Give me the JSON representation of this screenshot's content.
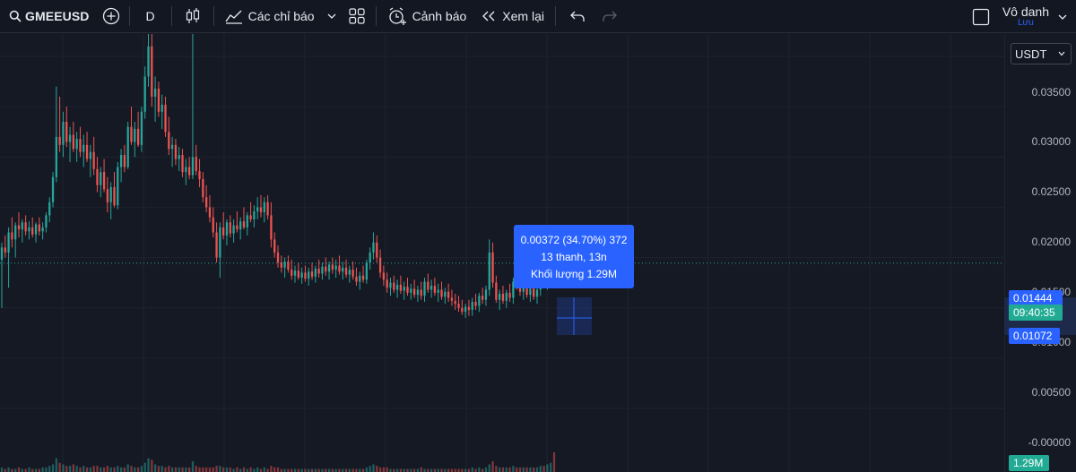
{
  "toolbar": {
    "symbol": "GMEEUSD",
    "interval": "D",
    "indicators_label": "Các chỉ báo",
    "alert_label": "Cảnh báo",
    "replay_label": "Xem lại",
    "user_name": "Vô danh",
    "user_sub": "Lưu"
  },
  "price_axis": {
    "currency": "USDT",
    "ticks": [
      "0.03500",
      "0.03000",
      "0.02500",
      "0.02000",
      "0.01500",
      "0.01000",
      "0.00500",
      "-0.00000"
    ],
    "last_price": "0.01444",
    "countdown": "09:40:35",
    "crosshair_price": "0.01072",
    "volume": "1.29M"
  },
  "tooltip": {
    "line1": "0.00372 (34.70%) 372",
    "line2": "13 thanh, 13n",
    "line3": "Khối lượng 1.29M"
  },
  "colors": {
    "up": "#26a69a",
    "down": "#ef5350",
    "background": "#151924",
    "accent": "#2962ff"
  },
  "chart_data": {
    "type": "candlestick",
    "title": "",
    "ylim": [
      -0.0005,
      0.0385
    ],
    "candles": [
      [
        0.0148,
        0.0165,
        0.01,
        0.016
      ],
      [
        0.016,
        0.0172,
        0.015,
        0.0155
      ],
      [
        0.0155,
        0.018,
        0.012,
        0.0175
      ],
      [
        0.0175,
        0.019,
        0.016,
        0.0168
      ],
      [
        0.0168,
        0.0185,
        0.015,
        0.0182
      ],
      [
        0.0182,
        0.0195,
        0.017,
        0.0178
      ],
      [
        0.0178,
        0.0188,
        0.0165,
        0.0185
      ],
      [
        0.0185,
        0.0192,
        0.0172,
        0.0176
      ],
      [
        0.0176,
        0.0186,
        0.0168,
        0.018
      ],
      [
        0.018,
        0.019,
        0.017,
        0.0173
      ],
      [
        0.0173,
        0.0185,
        0.0165,
        0.0183
      ],
      [
        0.0183,
        0.019,
        0.0172,
        0.0176
      ],
      [
        0.0176,
        0.0185,
        0.0168,
        0.018
      ],
      [
        0.018,
        0.0195,
        0.0175,
        0.0192
      ],
      [
        0.0192,
        0.021,
        0.0185,
        0.0205
      ],
      [
        0.0205,
        0.0235,
        0.02,
        0.023
      ],
      [
        0.023,
        0.032,
        0.0225,
        0.027
      ],
      [
        0.027,
        0.031,
        0.0255,
        0.0262
      ],
      [
        0.0262,
        0.0295,
        0.025,
        0.0285
      ],
      [
        0.0285,
        0.03,
        0.026,
        0.0265
      ],
      [
        0.0265,
        0.028,
        0.0245,
        0.0272
      ],
      [
        0.0272,
        0.0285,
        0.0255,
        0.0258
      ],
      [
        0.0258,
        0.0275,
        0.0245,
        0.0268
      ],
      [
        0.0268,
        0.028,
        0.025,
        0.0255
      ],
      [
        0.0255,
        0.0272,
        0.024,
        0.0262
      ],
      [
        0.0262,
        0.0275,
        0.0245,
        0.0248
      ],
      [
        0.0248,
        0.0262,
        0.023,
        0.0255
      ],
      [
        0.0255,
        0.027,
        0.0232,
        0.0238
      ],
      [
        0.0238,
        0.025,
        0.0215,
        0.0222
      ],
      [
        0.0222,
        0.024,
        0.021,
        0.0235
      ],
      [
        0.0235,
        0.0248,
        0.0215,
        0.0218
      ],
      [
        0.0218,
        0.023,
        0.0195,
        0.0205
      ],
      [
        0.0205,
        0.0225,
        0.0188,
        0.022
      ],
      [
        0.022,
        0.0235,
        0.02,
        0.0202
      ],
      [
        0.0202,
        0.0245,
        0.0198,
        0.024
      ],
      [
        0.024,
        0.0258,
        0.0225,
        0.0252
      ],
      [
        0.0252,
        0.0262,
        0.0235,
        0.024
      ],
      [
        0.024,
        0.0285,
        0.0238,
        0.028
      ],
      [
        0.028,
        0.03,
        0.0262,
        0.0265
      ],
      [
        0.0265,
        0.0285,
        0.025,
        0.0278
      ],
      [
        0.0278,
        0.0295,
        0.026,
        0.0262
      ],
      [
        0.0262,
        0.03,
        0.0255,
        0.0295
      ],
      [
        0.0295,
        0.034,
        0.0288,
        0.033
      ],
      [
        0.033,
        0.0385,
        0.032,
        0.036
      ],
      [
        0.036,
        0.0385,
        0.03,
        0.031
      ],
      [
        0.031,
        0.033,
        0.0285,
        0.0318
      ],
      [
        0.0318,
        0.0325,
        0.029,
        0.0295
      ],
      [
        0.0295,
        0.0312,
        0.0278,
        0.0302
      ],
      [
        0.0302,
        0.031,
        0.027,
        0.0275
      ],
      [
        0.0275,
        0.029,
        0.0252,
        0.0258
      ],
      [
        0.0258,
        0.027,
        0.024,
        0.0262
      ],
      [
        0.0262,
        0.0268,
        0.0242,
        0.0248
      ],
      [
        0.0248,
        0.026,
        0.0236,
        0.0252
      ],
      [
        0.0252,
        0.0258,
        0.023,
        0.0235
      ],
      [
        0.0235,
        0.0248,
        0.0222,
        0.024
      ],
      [
        0.024,
        0.025,
        0.0228,
        0.0232
      ],
      [
        0.0232,
        0.0385,
        0.0228,
        0.025
      ],
      [
        0.025,
        0.0262,
        0.0232,
        0.0236
      ],
      [
        0.0236,
        0.0248,
        0.022,
        0.0228
      ],
      [
        0.0228,
        0.0235,
        0.0205,
        0.021
      ],
      [
        0.021,
        0.0222,
        0.0195,
        0.02
      ],
      [
        0.02,
        0.0212,
        0.0185,
        0.019
      ],
      [
        0.019,
        0.02,
        0.017,
        0.0175
      ],
      [
        0.0175,
        0.0185,
        0.0145,
        0.015
      ],
      [
        0.015,
        0.0185,
        0.013,
        0.018
      ],
      [
        0.018,
        0.0195,
        0.0168,
        0.0172
      ],
      [
        0.0172,
        0.0188,
        0.0162,
        0.0185
      ],
      [
        0.0185,
        0.0192,
        0.017,
        0.0174
      ],
      [
        0.0174,
        0.0188,
        0.0165,
        0.0182
      ],
      [
        0.0182,
        0.0196,
        0.0175,
        0.0178
      ],
      [
        0.0178,
        0.019,
        0.0168,
        0.0186
      ],
      [
        0.0186,
        0.02,
        0.0178,
        0.018
      ],
      [
        0.018,
        0.0195,
        0.0172,
        0.0192
      ],
      [
        0.0192,
        0.0205,
        0.0185,
        0.0188
      ],
      [
        0.0188,
        0.0202,
        0.018,
        0.0196
      ],
      [
        0.0196,
        0.021,
        0.0188,
        0.02
      ],
      [
        0.02,
        0.0212,
        0.019,
        0.0195
      ],
      [
        0.0195,
        0.021,
        0.0185,
        0.0205
      ],
      [
        0.0205,
        0.0212,
        0.0188,
        0.0192
      ],
      [
        0.0192,
        0.0205,
        0.016,
        0.0168
      ],
      [
        0.0168,
        0.0175,
        0.015,
        0.0155
      ],
      [
        0.0155,
        0.0162,
        0.014,
        0.0145
      ],
      [
        0.0145,
        0.0152,
        0.0135,
        0.014
      ],
      [
        0.014,
        0.015,
        0.013,
        0.0146
      ],
      [
        0.0146,
        0.0152,
        0.0135,
        0.0138
      ],
      [
        0.0138,
        0.0148,
        0.0128,
        0.0132
      ],
      [
        0.0132,
        0.0142,
        0.0125,
        0.0137
      ],
      [
        0.0137,
        0.0145,
        0.0128,
        0.013
      ],
      [
        0.013,
        0.014,
        0.0124,
        0.0135
      ],
      [
        0.0135,
        0.0142,
        0.0126,
        0.0129
      ],
      [
        0.0129,
        0.014,
        0.0122,
        0.0136
      ],
      [
        0.0136,
        0.0145,
        0.0128,
        0.0131
      ],
      [
        0.0131,
        0.0142,
        0.0125,
        0.0139
      ],
      [
        0.0139,
        0.0148,
        0.013,
        0.0134
      ],
      [
        0.0134,
        0.0145,
        0.0128,
        0.0141
      ],
      [
        0.0141,
        0.015,
        0.0132,
        0.0136
      ],
      [
        0.0136,
        0.0146,
        0.0128,
        0.0143
      ],
      [
        0.0143,
        0.015,
        0.0134,
        0.0138
      ],
      [
        0.0138,
        0.0148,
        0.013,
        0.0142
      ],
      [
        0.0142,
        0.0152,
        0.0133,
        0.0136
      ],
      [
        0.0136,
        0.0146,
        0.0128,
        0.014
      ],
      [
        0.014,
        0.0148,
        0.013,
        0.0133
      ],
      [
        0.0133,
        0.0142,
        0.0125,
        0.0138
      ],
      [
        0.0138,
        0.0146,
        0.0128,
        0.0131
      ],
      [
        0.0131,
        0.014,
        0.0122,
        0.0126
      ],
      [
        0.0126,
        0.0136,
        0.0118,
        0.0132
      ],
      [
        0.0132,
        0.0142,
        0.0125,
        0.0128
      ],
      [
        0.0128,
        0.0148,
        0.0124,
        0.0145
      ],
      [
        0.0145,
        0.016,
        0.0138,
        0.0155
      ],
      [
        0.0155,
        0.0175,
        0.0148,
        0.0165
      ],
      [
        0.0165,
        0.0172,
        0.0145,
        0.015
      ],
      [
        0.015,
        0.0158,
        0.013,
        0.0135
      ],
      [
        0.0135,
        0.0142,
        0.0122,
        0.0128
      ],
      [
        0.0128,
        0.0135,
        0.0115,
        0.012
      ],
      [
        0.012,
        0.013,
        0.0112,
        0.0125
      ],
      [
        0.0125,
        0.0132,
        0.0115,
        0.0118
      ],
      [
        0.0118,
        0.0128,
        0.011,
        0.0123
      ],
      [
        0.0123,
        0.0132,
        0.0114,
        0.0117
      ],
      [
        0.0117,
        0.0126,
        0.0108,
        0.0121
      ],
      [
        0.0121,
        0.013,
        0.0112,
        0.0115
      ],
      [
        0.0115,
        0.0124,
        0.0108,
        0.0119
      ],
      [
        0.0119,
        0.0128,
        0.011,
        0.0113
      ],
      [
        0.0113,
        0.0122,
        0.0106,
        0.0118
      ],
      [
        0.0118,
        0.0126,
        0.0108,
        0.0112
      ],
      [
        0.0112,
        0.013,
        0.0106,
        0.0126
      ],
      [
        0.0126,
        0.0134,
        0.0115,
        0.0118
      ],
      [
        0.0118,
        0.0128,
        0.011,
        0.0122
      ],
      [
        0.0122,
        0.013,
        0.0112,
        0.0115
      ],
      [
        0.0115,
        0.0124,
        0.0106,
        0.0118
      ],
      [
        0.0118,
        0.0126,
        0.0108,
        0.0111
      ],
      [
        0.0111,
        0.012,
        0.0104,
        0.0116
      ],
      [
        0.0116,
        0.0124,
        0.0106,
        0.011
      ],
      [
        0.011,
        0.0118,
        0.0102,
        0.0107
      ],
      [
        0.0107,
        0.0114,
        0.0098,
        0.0104
      ],
      [
        0.0104,
        0.0112,
        0.0096,
        0.01
      ],
      [
        0.01,
        0.0108,
        0.0093,
        0.0096
      ],
      [
        0.0096,
        0.0104,
        0.009,
        0.0101
      ],
      [
        0.0101,
        0.0108,
        0.0092,
        0.0098
      ],
      [
        0.0098,
        0.011,
        0.0092,
        0.0106
      ],
      [
        0.0106,
        0.0114,
        0.0098,
        0.0102
      ],
      [
        0.0102,
        0.0115,
        0.0096,
        0.0112
      ],
      [
        0.0112,
        0.012,
        0.0104,
        0.0108
      ],
      [
        0.0108,
        0.0122,
        0.0102,
        0.0118
      ],
      [
        0.0118,
        0.0168,
        0.0112,
        0.0155
      ],
      [
        0.0155,
        0.0165,
        0.012,
        0.0125
      ],
      [
        0.0125,
        0.0132,
        0.0105,
        0.0108
      ],
      [
        0.0108,
        0.0118,
        0.0098,
        0.0114
      ],
      [
        0.0114,
        0.0122,
        0.0104,
        0.0107
      ],
      [
        0.0107,
        0.0118,
        0.01,
        0.0115
      ],
      [
        0.0115,
        0.0124,
        0.0106,
        0.011
      ],
      [
        0.011,
        0.013,
        0.0104,
        0.0126
      ],
      [
        0.0126,
        0.014,
        0.0118,
        0.0122
      ],
      [
        0.0122,
        0.0132,
        0.0112,
        0.0116
      ],
      [
        0.0116,
        0.0126,
        0.0108,
        0.012
      ],
      [
        0.012,
        0.0128,
        0.011,
        0.0113
      ],
      [
        0.0113,
        0.0124,
        0.0106,
        0.0119
      ],
      [
        0.0119,
        0.0126,
        0.0108,
        0.0111
      ],
      [
        0.0111,
        0.0122,
        0.0104,
        0.0118
      ],
      [
        0.0118,
        0.0138,
        0.0112,
        0.0134
      ],
      [
        0.0134,
        0.0142,
        0.012,
        0.0125
      ],
      [
        0.0125,
        0.014,
        0.0118,
        0.0136
      ],
      [
        0.0136,
        0.0152,
        0.013,
        0.0148
      ],
      [
        0.0148,
        0.016,
        0.014,
        0.0144
      ]
    ],
    "volumes": [
      0.3,
      0.2,
      0.3,
      0.2,
      0.2,
      0.3,
      0.2,
      0.2,
      0.3,
      0.2,
      0.2,
      0.2,
      0.3,
      0.3,
      0.4,
      0.5,
      0.9,
      0.6,
      0.5,
      0.4,
      0.4,
      0.5,
      0.4,
      0.3,
      0.4,
      0.3,
      0.3,
      0.4,
      0.4,
      0.3,
      0.3,
      0.4,
      0.3,
      0.3,
      0.4,
      0.3,
      0.3,
      0.5,
      0.4,
      0.3,
      0.3,
      0.4,
      0.6,
      0.9,
      0.8,
      0.5,
      0.4,
      0.4,
      0.3,
      0.4,
      0.3,
      0.3,
      0.3,
      0.3,
      0.3,
      0.3,
      0.7,
      0.4,
      0.3,
      0.3,
      0.3,
      0.3,
      0.3,
      0.4,
      0.4,
      0.3,
      0.3,
      0.3,
      0.2,
      0.3,
      0.2,
      0.3,
      0.2,
      0.3,
      0.2,
      0.3,
      0.2,
      0.3,
      0.2,
      0.4,
      0.3,
      0.3,
      0.2,
      0.2,
      0.2,
      0.2,
      0.2,
      0.2,
      0.2,
      0.2,
      0.2,
      0.2,
      0.2,
      0.2,
      0.2,
      0.2,
      0.2,
      0.2,
      0.2,
      0.2,
      0.2,
      0.2,
      0.2,
      0.2,
      0.2,
      0.2,
      0.2,
      0.3,
      0.4,
      0.5,
      0.4,
      0.3,
      0.3,
      0.3,
      0.2,
      0.2,
      0.2,
      0.2,
      0.2,
      0.2,
      0.2,
      0.2,
      0.2,
      0.3,
      0.2,
      0.2,
      0.2,
      0.2,
      0.2,
      0.2,
      0.2,
      0.2,
      0.2,
      0.2,
      0.2,
      0.2,
      0.2,
      0.2,
      0.3,
      0.2,
      0.3,
      0.2,
      0.3,
      0.5,
      0.7,
      0.4,
      0.3,
      0.3,
      0.3,
      0.3,
      0.4,
      0.3,
      0.3,
      0.3,
      0.3,
      0.3,
      0.3,
      0.3,
      0.4,
      0.4,
      0.5,
      0.6,
      1.29
    ]
  }
}
